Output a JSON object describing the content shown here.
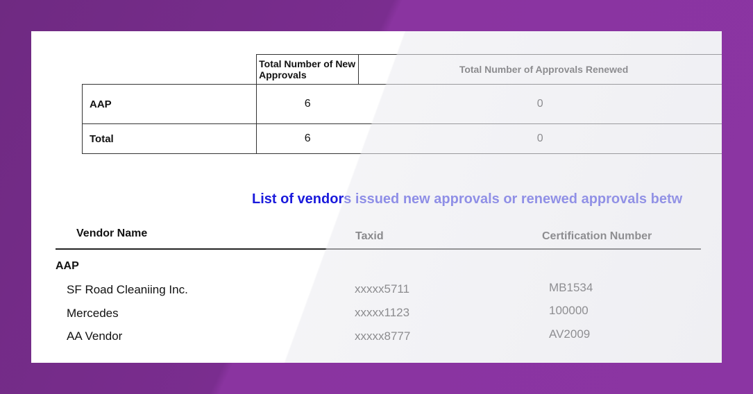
{
  "summary_table": {
    "headers": [
      "Total Number of New Approvals",
      "Total Number of Approvals Renewed"
    ],
    "rows": [
      {
        "label": "AAP",
        "new": "6",
        "renewed": "0"
      },
      {
        "label": "Total",
        "new": "6",
        "renewed": "0"
      }
    ]
  },
  "vendor_section": {
    "title": "List of vendors issued new approvals or renewed approvals betw",
    "columns": [
      "Vendor Name",
      "Taxid",
      "Certification Number"
    ],
    "group": "AAP",
    "vendors": [
      {
        "name": "SF Road Cleaniing Inc.",
        "taxid": "xxxxx5711",
        "cert": "MB1534"
      },
      {
        "name": "Mercedes",
        "taxid": "xxxxx1123",
        "cert": "100000"
      },
      {
        "name": "AA Vendor",
        "taxid": "xxxxx8777",
        "cert": "AV2009"
      }
    ]
  }
}
